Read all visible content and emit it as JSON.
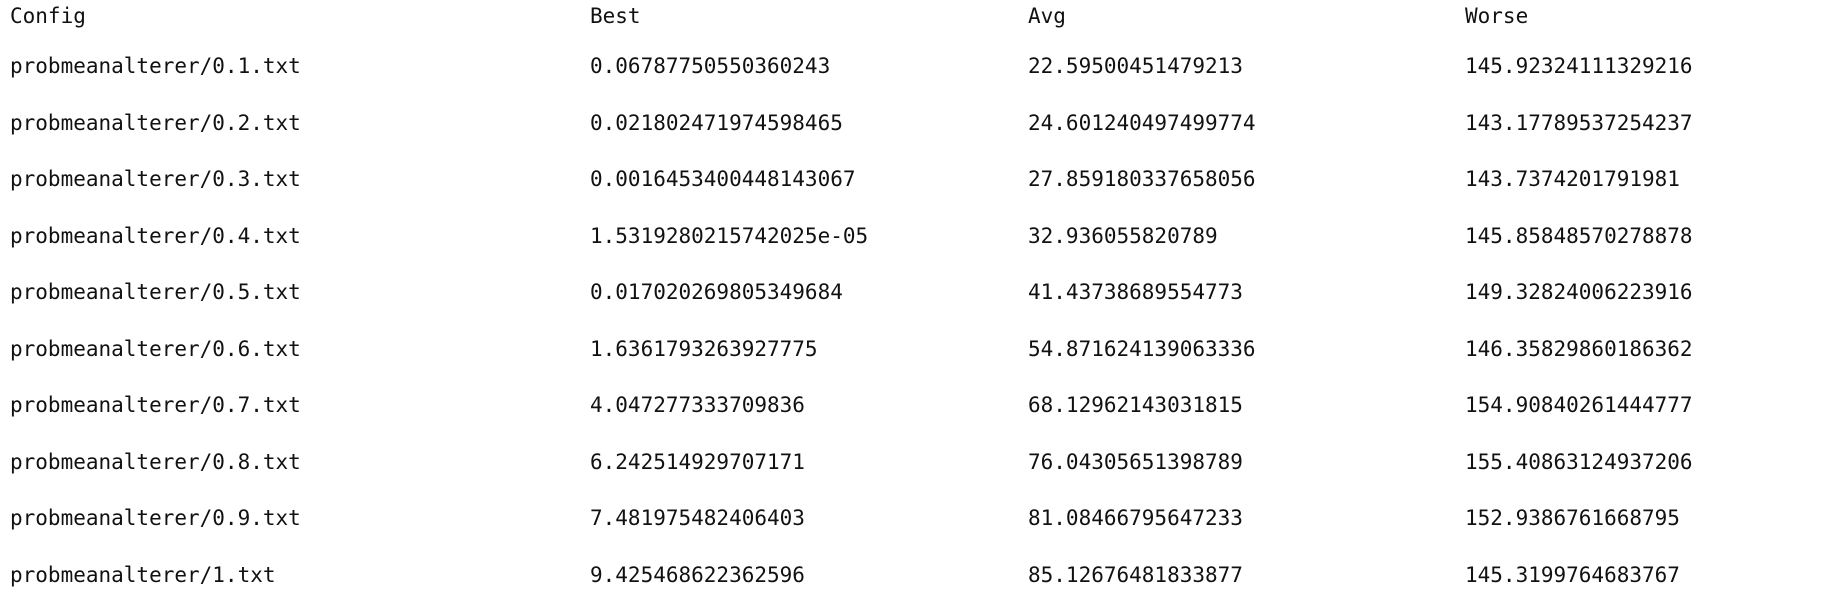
{
  "table": {
    "headers": [
      "Config",
      "Best",
      "Avg",
      "Worse"
    ],
    "rows": [
      [
        "probmeanalterer/0.1.txt",
        "0.06787750550360243",
        "22.59500451479213",
        "145.92324111329216"
      ],
      [
        "probmeanalterer/0.2.txt",
        "0.021802471974598465",
        "24.601240497499774",
        "143.17789537254237"
      ],
      [
        "probmeanalterer/0.3.txt",
        "0.0016453400448143067",
        "27.859180337658056",
        "143.7374201791981"
      ],
      [
        "probmeanalterer/0.4.txt",
        "1.5319280215742025e-05",
        "32.936055820789",
        "145.85848570278878"
      ],
      [
        "probmeanalterer/0.5.txt",
        "0.017020269805349684",
        "41.43738689554773",
        "149.32824006223916"
      ],
      [
        "probmeanalterer/0.6.txt",
        "1.6361793263927775",
        "54.871624139063336",
        "146.35829860186362"
      ],
      [
        "probmeanalterer/0.7.txt",
        "4.047277333709836",
        "68.12962143031815",
        "154.90840261444777"
      ],
      [
        "probmeanalterer/0.8.txt",
        "6.242514929707171",
        "76.04305651398789",
        "155.40863124937206"
      ],
      [
        "probmeanalterer/0.9.txt",
        "7.481975482406403",
        "81.08466795647233",
        "152.9386761668795"
      ],
      [
        "probmeanalterer/1.txt",
        "9.425468622362596",
        "85.12676481833877",
        "145.3199764683767"
      ]
    ]
  }
}
